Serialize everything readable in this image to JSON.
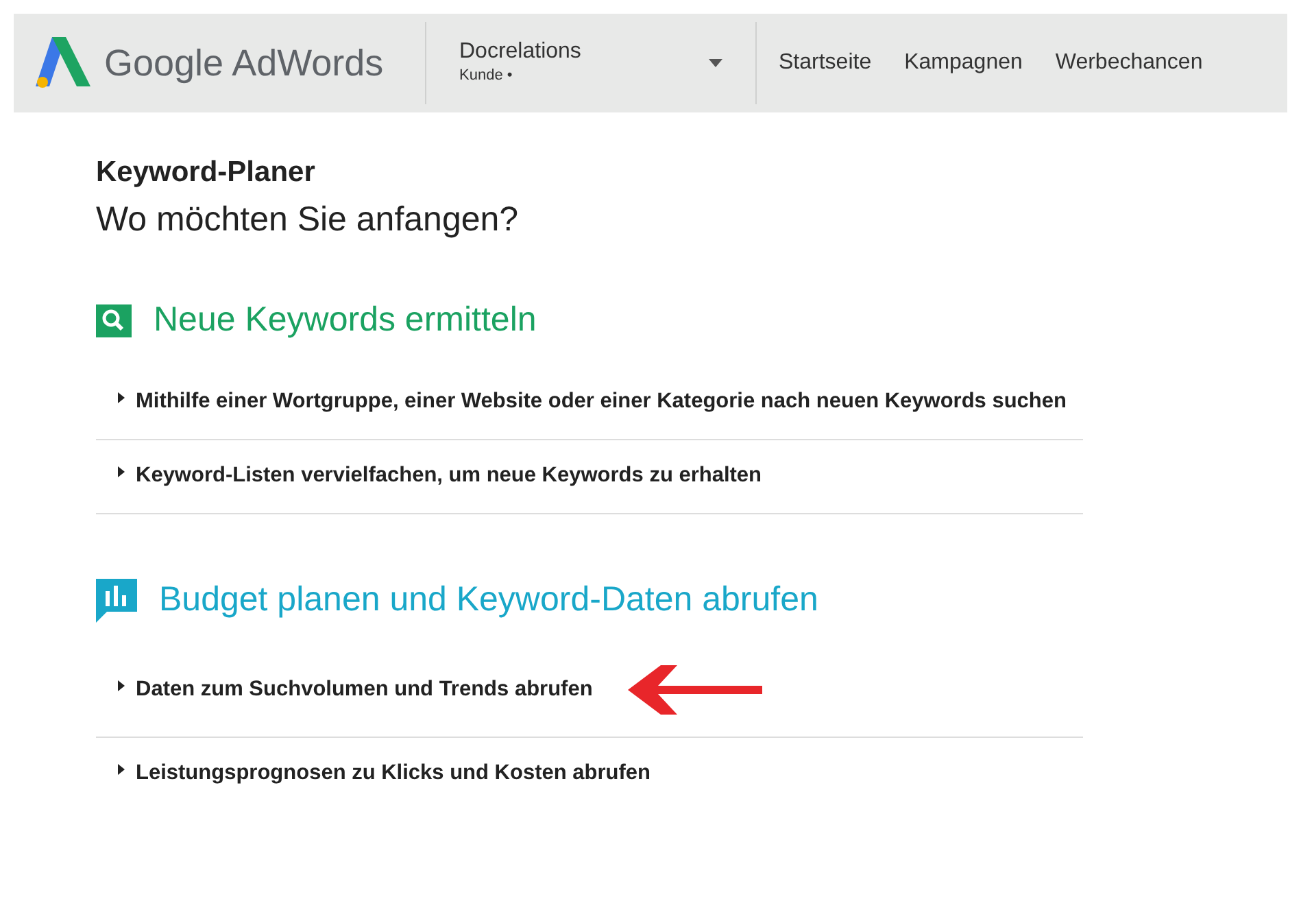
{
  "header": {
    "logo_text": "Google AdWords",
    "account": {
      "name": "Docrelations",
      "subtitle": "Kunde •"
    },
    "nav": [
      {
        "label": "Startseite"
      },
      {
        "label": "Kampagnen"
      },
      {
        "label": "Werbechancen"
      }
    ]
  },
  "page": {
    "title": "Keyword-Planer",
    "subtitle": "Wo möchten Sie anfangen?"
  },
  "sections": [
    {
      "kind": "search",
      "title": "Neue Keywords ermitteln",
      "items": [
        {
          "label": "Mithilfe einer Wortgruppe, einer Website oder einer Kategorie nach neuen Keywords suchen",
          "arrow": false
        },
        {
          "label": "Keyword-Listen vervielfachen, um neue Keywords zu erhalten",
          "arrow": false
        }
      ]
    },
    {
      "kind": "chart",
      "title": "Budget planen und Keyword-Daten abrufen",
      "items": [
        {
          "label": "Daten zum Suchvolumen und Trends abrufen",
          "arrow": true
        },
        {
          "label": "Leistungsprognosen zu Klicks und Kosten abrufen",
          "arrow": false
        }
      ]
    }
  ]
}
